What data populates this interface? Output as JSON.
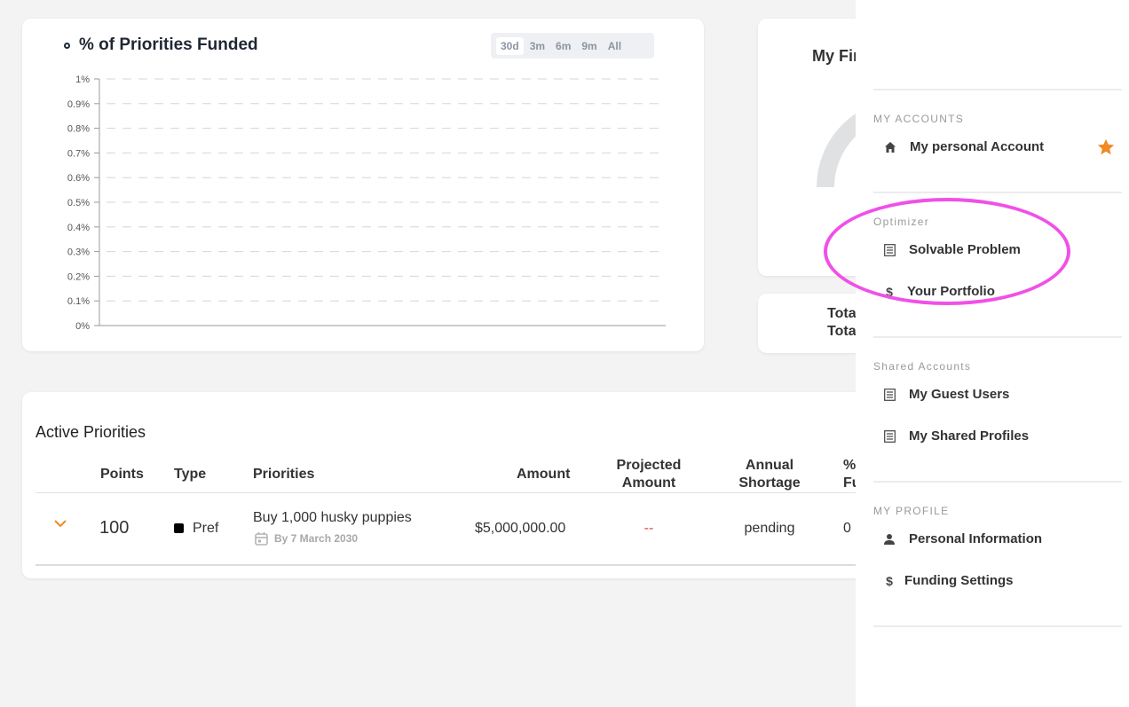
{
  "chart": {
    "title": "% of Priorities Funded",
    "ranges": [
      "30d",
      "3m",
      "6m",
      "9m",
      "All"
    ],
    "active_range": "30d"
  },
  "chart_data": {
    "type": "line",
    "title": "% of Priorities Funded",
    "y_ticks": [
      "1%",
      "0.9%",
      "0.8%",
      "0.7%",
      "0.6%",
      "0.5%",
      "0.4%",
      "0.3%",
      "0.2%",
      "0.1%",
      "0%"
    ],
    "ylim": [
      0,
      1
    ],
    "series": [],
    "grid": true
  },
  "financial_card": {
    "title_partial": "My Fin"
  },
  "totals_card": {
    "line1": "Tota",
    "line2": "Tota"
  },
  "priorities": {
    "title": "Active Priorities",
    "columns": {
      "points": "Points",
      "type": "Type",
      "priorities": "Priorities",
      "amount": "Amount",
      "projected_line1": "Projected",
      "projected_line2": "Amount",
      "shortage_line1": "Annual",
      "shortage_line2": "Shortage",
      "funded_line1": "%",
      "funded_line2": "Fu"
    },
    "rows": [
      {
        "points": "100",
        "type": "Pref",
        "name": "Buy 1,000 husky puppies",
        "date": "By 7 March 2030",
        "amount": "$5,000,000.00",
        "projected": "--",
        "shortage": "pending",
        "funded": "0"
      }
    ]
  },
  "sidebar": {
    "my_accounts": {
      "heading": "MY ACCOUNTS",
      "items": [
        {
          "label": "My personal Account",
          "icon": "home-icon",
          "starred": true
        }
      ]
    },
    "optimizer": {
      "heading": "Optimizer",
      "items": [
        {
          "label": "Solvable Problem",
          "icon": "list-icon"
        },
        {
          "label": "Your Portfolio",
          "icon": "dollar-icon"
        }
      ]
    },
    "shared": {
      "heading": "Shared Accounts",
      "items": [
        {
          "label": "My Guest Users",
          "icon": "list-icon"
        },
        {
          "label": "My Shared Profiles",
          "icon": "list-icon"
        }
      ]
    },
    "profile": {
      "heading": "MY PROFILE",
      "items": [
        {
          "label": "Personal Information",
          "icon": "person-icon"
        },
        {
          "label": "Funding Settings",
          "icon": "dollar-icon"
        }
      ]
    }
  },
  "colors": {
    "accent_orange": "#f08a24",
    "star": "#f08a24",
    "highlight": "#f050e8",
    "projected_red": "#e0483a"
  }
}
